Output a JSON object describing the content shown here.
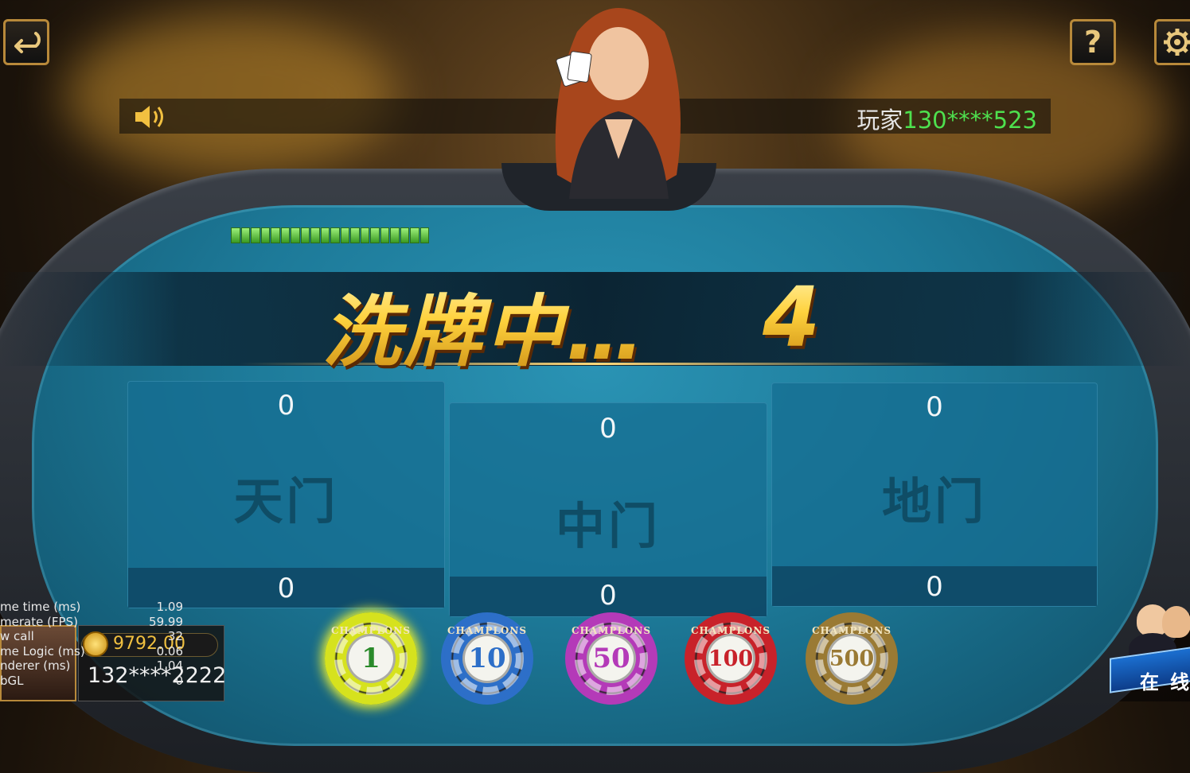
{
  "header": {
    "player_prefix": "玩家",
    "player_id": "130****523",
    "help_label": "?"
  },
  "status": {
    "shuffling_text": "洗牌中…",
    "countdown": "4",
    "progress_segments": 20
  },
  "zones": [
    {
      "name": "天门",
      "top_value": "0",
      "bottom_value": "0"
    },
    {
      "name": "中门",
      "top_value": "0",
      "bottom_value": "0"
    },
    {
      "name": "地门",
      "top_value": "0",
      "bottom_value": "0"
    }
  ],
  "chips": [
    {
      "value": "1",
      "color": "#d6e21e",
      "text_color": "#2a8a2a",
      "brand": "CHAMPLONS"
    },
    {
      "value": "10",
      "color": "#2d6fc8",
      "text_color": "#2d6fc8",
      "brand": "CHAMPLONS"
    },
    {
      "value": "50",
      "color": "#b43ab8",
      "text_color": "#b43ab8",
      "brand": "CHAMPLONS"
    },
    {
      "value": "100",
      "color": "#c8222a",
      "text_color": "#c8222a",
      "brand": "CHAMPLONS"
    },
    {
      "value": "500",
      "color": "#9a7a34",
      "text_color": "#9a7a34",
      "brand": "CHAMPLONS"
    }
  ],
  "debug": [
    {
      "label": "me time (ms)",
      "value": "1.09"
    },
    {
      "label": "merate (FPS)",
      "value": "59.99"
    },
    {
      "label": "w call",
      "value": "32"
    },
    {
      "label": "me Logic (ms)",
      "value": "0.06"
    },
    {
      "label": "nderer (ms)",
      "value": "1.04"
    },
    {
      "label": "bGL",
      "value": "0"
    }
  ],
  "user": {
    "coins": "9792.00",
    "username": "132****2222"
  },
  "online": {
    "label": "在线"
  },
  "icons": {
    "back": "back-arrow-icon",
    "help": "question-icon",
    "settings": "gear-icon",
    "sound": "speaker-icon",
    "coin": "gold-coin-icon",
    "online": "online-players-icon"
  }
}
